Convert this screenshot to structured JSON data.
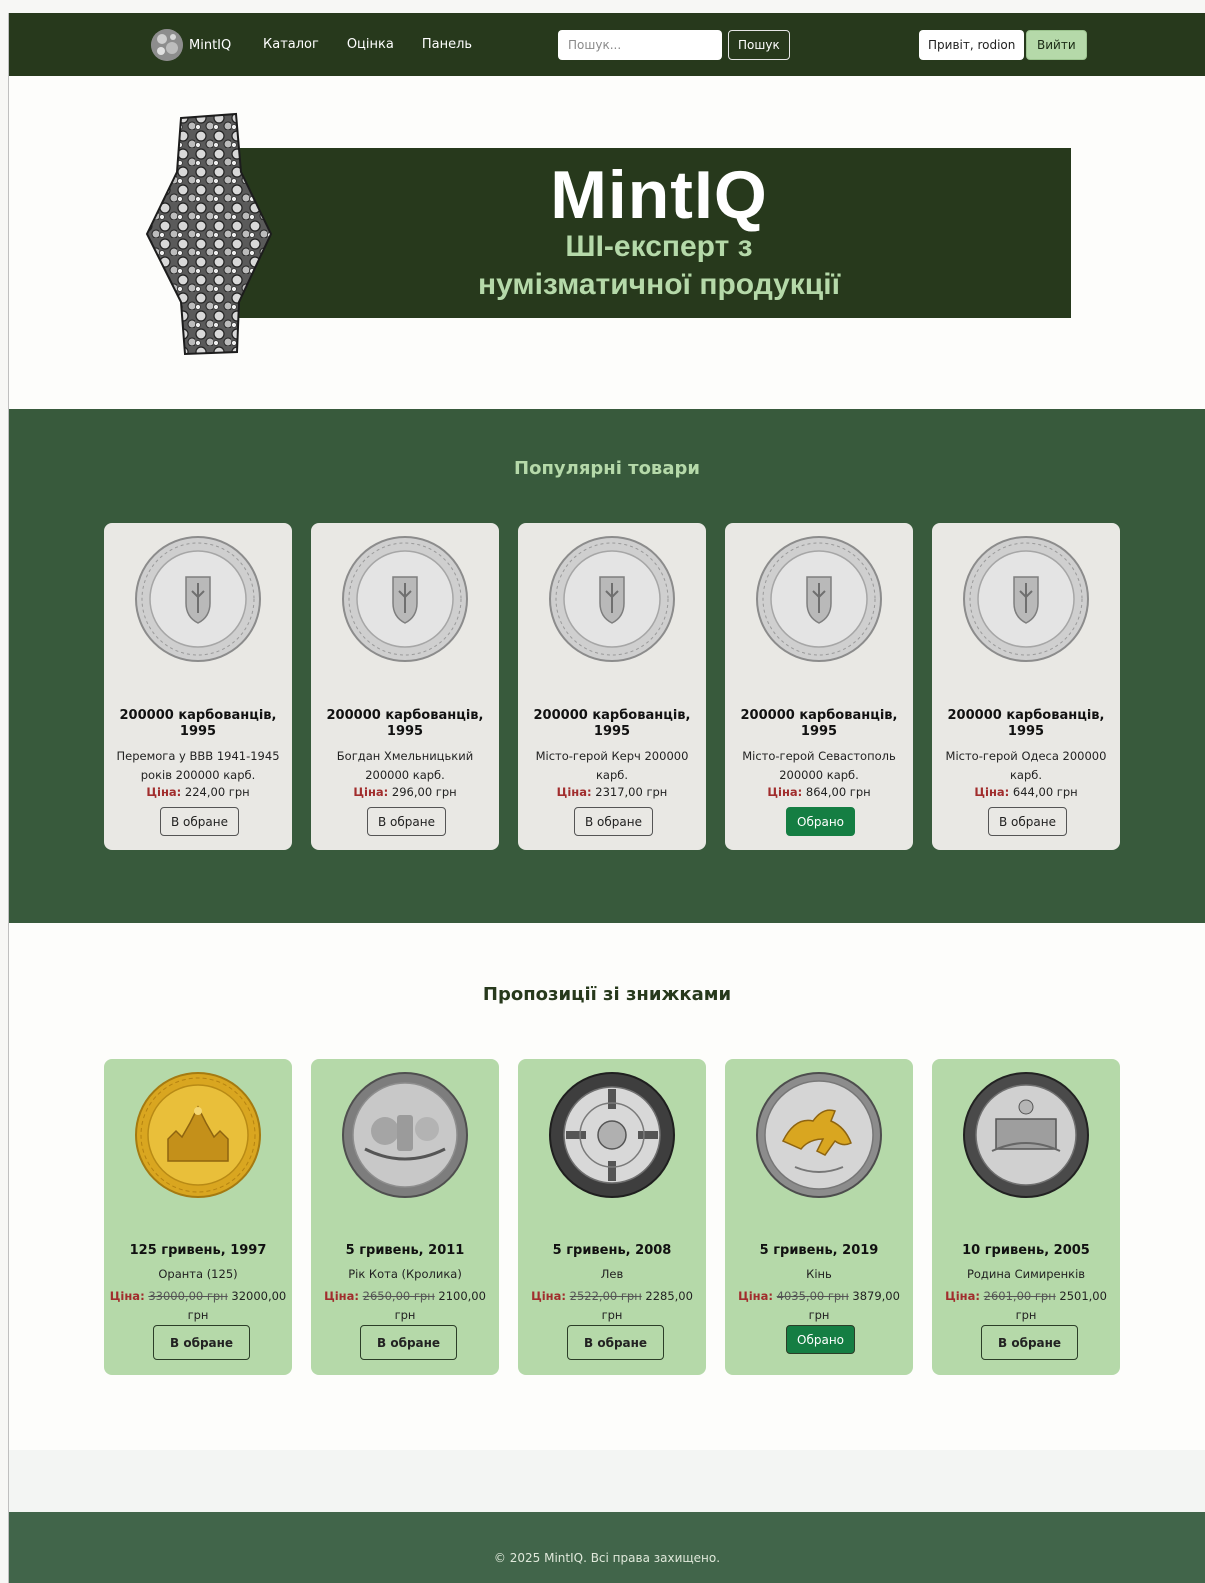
{
  "navbar": {
    "brand": "MintIQ",
    "links": [
      "Каталог",
      "Оцінка",
      "Панель"
    ],
    "search_placeholder": "Пошук...",
    "search_button": "Пошук",
    "greeting": "Привіт, rodion",
    "logout": "Вийти"
  },
  "hero": {
    "title": "MintIQ",
    "subtitle_line1": "ШІ-експерт з",
    "subtitle_line2": "нумізматичної продукції"
  },
  "popular": {
    "title": "Популярні товари",
    "items": [
      {
        "name": "200000 карбованців, 1995",
        "desc": "Перемога у ВВВ 1941-1945 років 200000 карб.",
        "price_label": "Ціна:",
        "price": "224,00 грн",
        "button": "В обране"
      },
      {
        "name": "200000 карбованців, 1995",
        "desc": "Богдан Хмельницький 200000 карб.",
        "price_label": "Ціна:",
        "price": "296,00 грн",
        "button": "В обране"
      },
      {
        "name": "200000 карбованців, 1995",
        "desc": "Місто-герой Керч 200000 карб.",
        "price_label": "Ціна:",
        "price": "2317,00 грн",
        "button": "В обране"
      },
      {
        "name": "200000 карбованців, 1995",
        "desc": "Місто-герой Севастополь 200000 карб.",
        "price_label": "Ціна:",
        "price": "864,00 грн",
        "button": "Обрано"
      },
      {
        "name": "200000 карбованців, 1995",
        "desc": "Місто-герой Одеса 200000 карб.",
        "price_label": "Ціна:",
        "price": "644,00 грн",
        "button": "В обране"
      }
    ]
  },
  "discounts": {
    "title": "Пропозиції зі знижками",
    "items": [
      {
        "name": "125 гривень, 1997",
        "desc": "Оранта (125)",
        "price_label": "Ціна:",
        "old_price": "33000,00 грн",
        "new_price": "32000,00 грн",
        "button": "В обране"
      },
      {
        "name": "5 гривень, 2011",
        "desc": "Рік Кота (Кролика)",
        "price_label": "Ціна:",
        "old_price": "2650,00 грн",
        "new_price": "2100,00 грн",
        "button": "В обране"
      },
      {
        "name": "5 гривень, 2008",
        "desc": "Лев",
        "price_label": "Ціна:",
        "old_price": "2522,00 грн",
        "new_price": "2285,00 грн",
        "button": "В обране"
      },
      {
        "name": "5 гривень, 2019",
        "desc": "Кінь",
        "price_label": "Ціна:",
        "old_price": "4035,00 грн",
        "new_price": "3879,00 грн",
        "button": "Обрано"
      },
      {
        "name": "10 гривень, 2005",
        "desc": "Родина Симиренків",
        "price_label": "Ціна:",
        "old_price": "2601,00 грн",
        "new_price": "2501,00 грн",
        "button": "В обране"
      }
    ]
  },
  "footer": {
    "text": "© 2025 MintIQ. Всі права захищено."
  },
  "colors": {
    "nav_bg": "#27391c",
    "popular_bg": "#385a3c",
    "accent_light_green": "#b5d9a9",
    "active_button": "#157e43",
    "price_label": "#a12d2d",
    "footer_bg": "#41654a"
  }
}
